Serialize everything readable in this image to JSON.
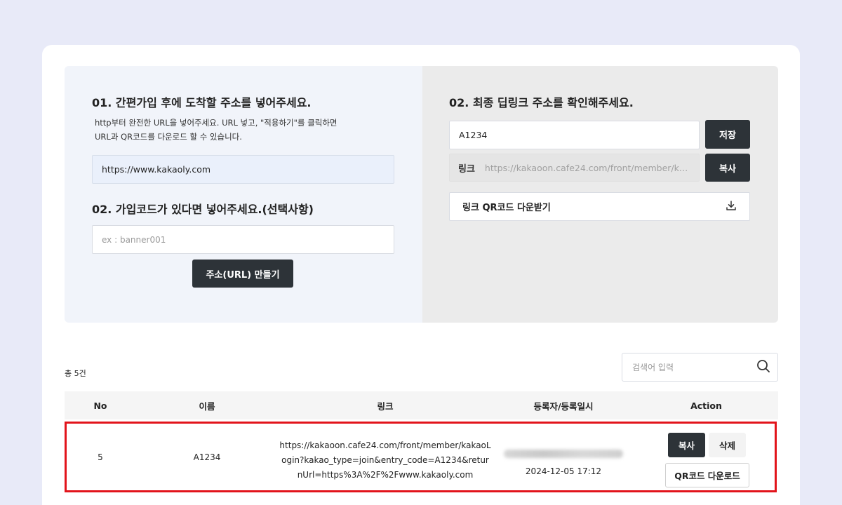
{
  "left_panel": {
    "step1_title": "01. 간편가입 후에 도착할 주소를 넣어주세요.",
    "step1_desc_line1": "http부터 완전한 URL을 넣어주세요. URL 넣고, \"적용하기\"를 클릭하면",
    "step1_desc_line2": "URL과 QR코드를 다운로드 할 수 있습니다.",
    "url_value": "https://www.kakaoly.com",
    "step2_title": "02. 가입코드가 있다면 넣어주세요.(선택사항)",
    "code_placeholder": "ex : banner001",
    "make_button": "주소(URL) 만들기"
  },
  "right_panel": {
    "title": "02. 최종 딥링크 주소를 확인해주세요.",
    "name_value": "A1234",
    "save_button": "저장",
    "link_label": "링크",
    "link_value": "https://kakaoon.cafe24.com/front/member/ka...",
    "copy_button": "복사",
    "qr_download_label": "링크 QR코드 다운받기"
  },
  "list": {
    "total_count": "총 5건",
    "search_placeholder": "검색어 입력",
    "columns": [
      "No",
      "이름",
      "링크",
      "등록자/등록일시",
      "Action"
    ],
    "rows": [
      {
        "no": "5",
        "name": "A1234",
        "link_line1": "https://kakaoon.cafe24.com/front/member/kakaoL",
        "link_line2": "ogin?kakao_type=join&entry_code=A1234&retur",
        "link_line3": "nUrl=https%3A%2F%2Fwww.kakaoly.com",
        "registered_at": "2024-12-05 17:12",
        "copy_button": "복사",
        "delete_button": "삭제",
        "qr_button": "QR코드 다운로드"
      }
    ]
  },
  "colors": {
    "page_bg": "#e8eaf8",
    "dark_button": "#2d3338",
    "highlight_border": "#e2141b"
  }
}
